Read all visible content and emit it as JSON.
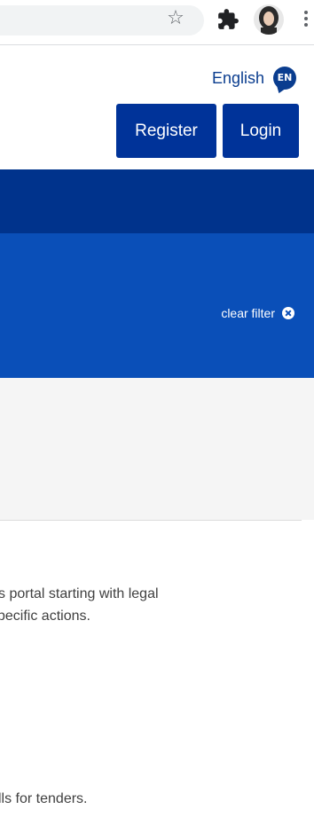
{
  "browser": {
    "star_icon": "star-outline-icon",
    "extensions_icon": "puzzle-icon",
    "profile_icon": "avatar",
    "menu_icon": "kebab-menu-icon"
  },
  "language": {
    "label": "English",
    "badge": "EN"
  },
  "auth": {
    "register_label": "Register",
    "login_label": "Login"
  },
  "filter": {
    "clear_label": "clear filter"
  },
  "content": {
    "line1": "s portal starting with legal",
    "line2": "pecific actions.",
    "line3": "lls for tenders."
  },
  "colors": {
    "primary": "#003399",
    "band_dark": "#00338c",
    "band_blue": "#0a4fb8",
    "text": "#404040"
  }
}
